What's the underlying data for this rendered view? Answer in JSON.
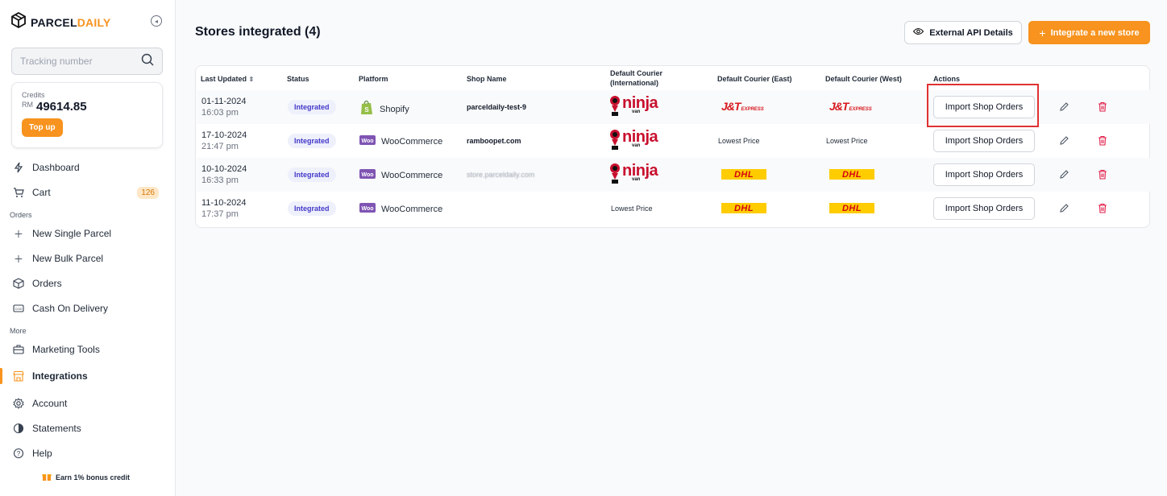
{
  "sidebar": {
    "brand": {
      "part1": "PARCEL",
      "part2": "DAILY"
    },
    "tracking_placeholder": "Tracking number",
    "credits": {
      "label": "Credits",
      "currency": "RM",
      "amount": "49614.85",
      "topup_label": "Top up"
    },
    "nav": {
      "dashboard": "Dashboard",
      "cart": "Cart",
      "cart_count": "126",
      "section_orders": "Orders",
      "new_single": "New Single Parcel",
      "new_bulk": "New Bulk Parcel",
      "orders": "Orders",
      "cod": "Cash On Delivery",
      "section_more": "More",
      "marketing": "Marketing Tools",
      "integrations": "Integrations",
      "account": "Account",
      "statements": "Statements",
      "help": "Help"
    },
    "earn": "Earn 1% bonus credit"
  },
  "main": {
    "title": "Stores integrated (4)",
    "external_api_label": "External API Details",
    "integrate_label": "Integrate a new store",
    "table": {
      "headers": {
        "last_updated": "Last Updated",
        "status": "Status",
        "platform": "Platform",
        "shop_name": "Shop Name",
        "courier_intl_1": "Default Courier",
        "courier_intl_2": "(International)",
        "courier_east": "Default Courier (East)",
        "courier_west": "Default Courier (West)",
        "actions": "Actions"
      },
      "rows": [
        {
          "date": "01-11-2024",
          "time": "16:03 pm",
          "status": "Integrated",
          "platform": "Shopify",
          "shop": "parceldaily-test-9",
          "intl": "ninja",
          "east": "J&T",
          "west": "J&T",
          "action": "Import Shop Orders"
        },
        {
          "date": "17-10-2024",
          "time": "21:47 pm",
          "status": "Integrated",
          "platform": "WooCommerce",
          "shop": "ramboopet.com",
          "intl": "ninja",
          "east": "Lowest Price",
          "west": "Lowest Price",
          "action": "Import Shop Orders"
        },
        {
          "date": "10-10-2024",
          "time": "16:33 pm",
          "status": "Integrated",
          "platform": "WooCommerce",
          "shop": "store.parceldaily.com",
          "intl": "ninja",
          "east": "DHL",
          "west": "DHL",
          "action": "Import Shop Orders"
        },
        {
          "date": "11-10-2024",
          "time": "17:37 pm",
          "status": "Integrated",
          "platform": "WooCommerce",
          "shop": "",
          "intl": "Lowest Price",
          "east": "DHL",
          "west": "DHL",
          "action": "Import Shop Orders"
        }
      ]
    },
    "logo_text": {
      "ninja": "ninja",
      "van": "van",
      "jt": "J&T",
      "express": "EXPRESS",
      "dhl": "DHL",
      "woo": "Woo"
    }
  },
  "colors": {
    "accent": "#f7931e",
    "brand_red": "#c8102e",
    "dhl_yellow": "#ffcc00",
    "highlight": "#e03131"
  }
}
